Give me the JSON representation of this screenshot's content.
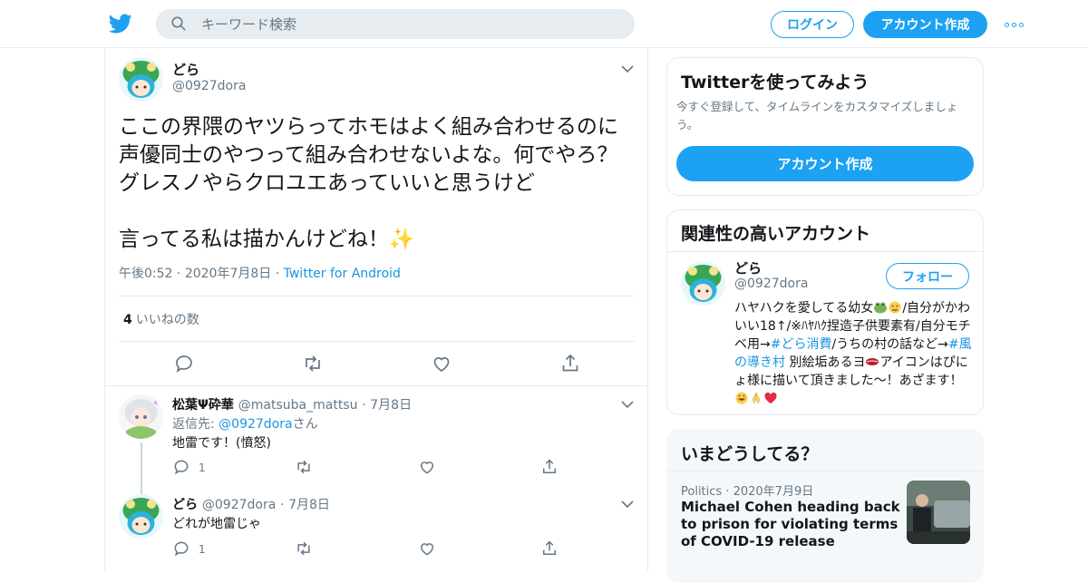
{
  "nav": {
    "search_placeholder": "キーワード検索",
    "login_label": "ログイン",
    "signup_label": "アカウント作成"
  },
  "tweet": {
    "name": "どら",
    "handle": "@0927dora",
    "text": "ここの界隈のヤツらってホモはよく組み合わせるのに声優同士のやつって組み合わせないよな。何でやろ？グレスノやらクロユエあっていいと思うけど\n\n言ってる私は描かんけどね！✨",
    "time": "午後0:52",
    "date": "2020年7月8日",
    "source": "Twitter for Android",
    "like_count": "4",
    "like_label": "いいねの数"
  },
  "replies": [
    {
      "name": "松葉Ψ砕華",
      "handle": "@matsuba_mattsu",
      "date": "7月8日",
      "reply_to_label": "返信先: ",
      "reply_to_mention": "@0927dora",
      "reply_to_suffix": "さん",
      "text": "地雷です！(憤怒)",
      "reply_count": "1"
    },
    {
      "name": "どら",
      "handle": "@0927dora",
      "date": "7月8日",
      "text": "どれが地雷じゃ",
      "reply_count": "1"
    }
  ],
  "sidebar": {
    "try_card": {
      "title": "Twitterを使ってみよう",
      "desc": "今すぐ登録して、タイムラインをカスタマイズしましょう。",
      "button": "アカウント作成"
    },
    "related": {
      "title": "関連性の高いアカウント",
      "name": "どら",
      "handle": "@0927dora",
      "follow": "フォロー",
      "bio_1": "ハヤハクを愛してる幼女",
      "bio_2": "/自分がかわいい18↑/※ﾊﾔﾊｸ捏造子供要素有/自分モチベ用→",
      "bio_tag1": "#どら消費",
      "bio_3": "/うちの村の話など→",
      "bio_tag2": "#風の導き村",
      "bio_4": " 別絵垢あるヨ",
      "bio_5": "アイコンはぴにょ様に描いて頂きました〜！あざます！"
    },
    "trends": {
      "title": "いまどうしてる？",
      "category": "Politics",
      "date": "2020年7月9日",
      "headline": "Michael Cohen heading back to prison for violating terms of COVID-19 release"
    }
  },
  "colors": {
    "accent": "#1da1f2",
    "link": "#1b95e0",
    "secondary_text": "#657786",
    "divider": "#e6ecf0",
    "like_heart": "#e0245e"
  },
  "icons": [
    "twitter-bird-icon",
    "search-icon",
    "more-dots-icon",
    "chevron-down-icon",
    "reply-icon",
    "retweet-icon",
    "heart-icon",
    "share-icon"
  ]
}
